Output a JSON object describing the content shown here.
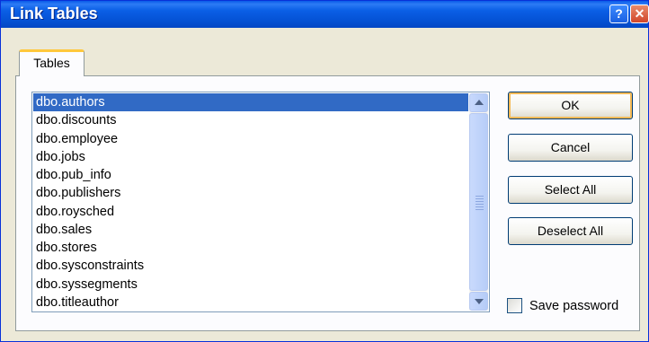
{
  "window": {
    "title": "Link Tables",
    "help_glyph": "?",
    "close_glyph": "✕"
  },
  "tabs": [
    {
      "label": "Tables",
      "active": true
    }
  ],
  "tables_list": {
    "items": [
      "dbo.authors",
      "dbo.discounts",
      "dbo.employee",
      "dbo.jobs",
      "dbo.pub_info",
      "dbo.publishers",
      "dbo.roysched",
      "dbo.sales",
      "dbo.stores",
      "dbo.sysconstraints",
      "dbo.syssegments",
      "dbo.titleauthor"
    ],
    "selected_index": 0
  },
  "buttons": {
    "ok": "OK",
    "cancel": "Cancel",
    "select_all": "Select All",
    "deselect_all": "Deselect All"
  },
  "save_password": {
    "label": "Save password",
    "checked": false
  },
  "colors": {
    "titlebar": "#0553d6",
    "selection": "#316ac5",
    "dialog_bg": "#ece9d8",
    "tab_highlight": "#ffc83c"
  }
}
